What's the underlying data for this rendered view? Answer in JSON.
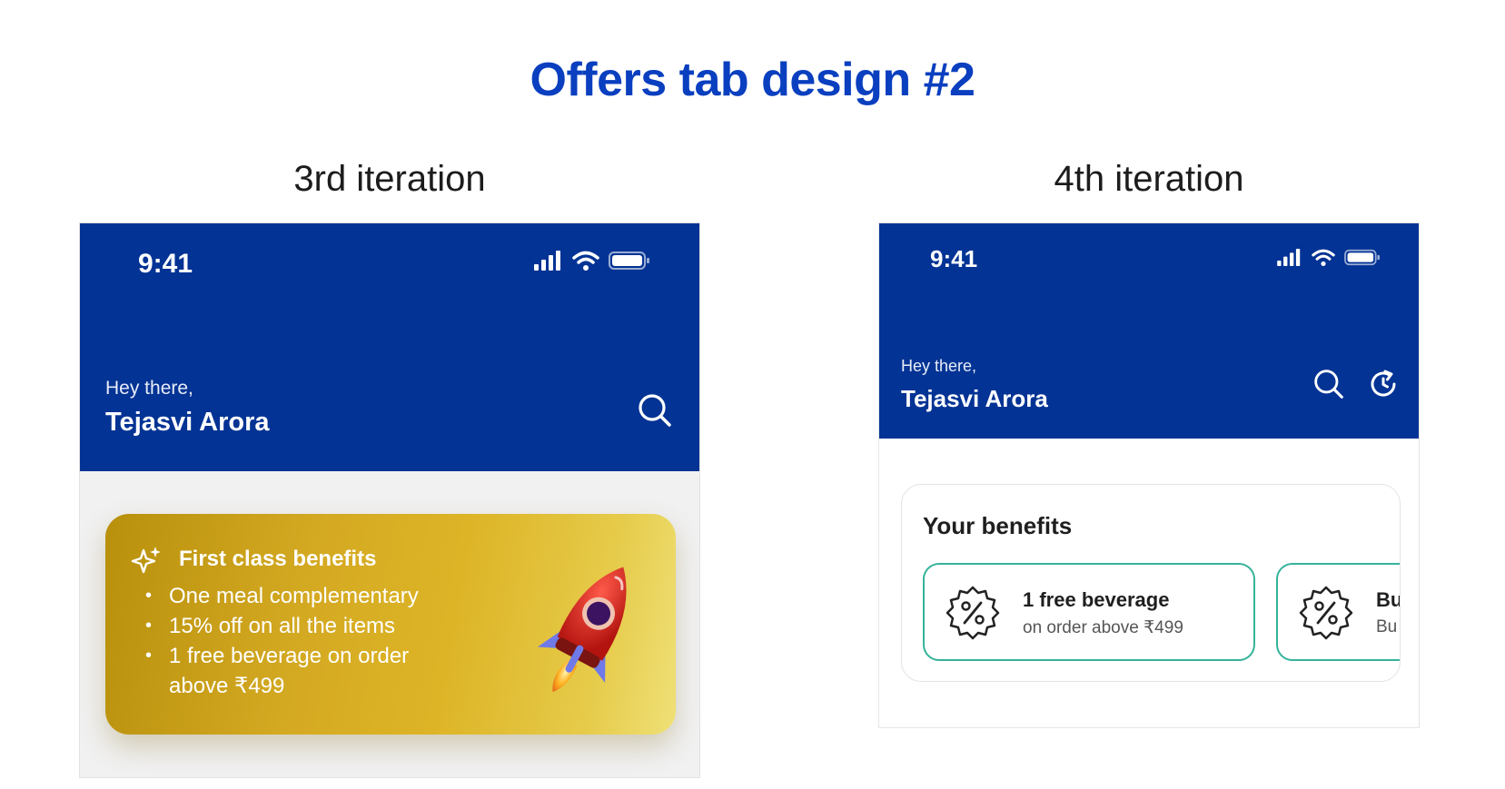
{
  "page": {
    "title": "Offers tab design #2",
    "left_label": "3rd iteration",
    "right_label": "4th iteration"
  },
  "colors": {
    "title_blue": "#0a3fbf",
    "header_blue": "#033394",
    "gold": "#d4a922",
    "benefit_border": "#35b39a"
  },
  "iteration3": {
    "status_time": "9:41",
    "greeting": "Hey there,",
    "user_name": "Tejasvi Arora",
    "header_icons": [
      "search-icon"
    ],
    "card": {
      "title": "First class benefits",
      "items": [
        "One meal complementary",
        "15% off on all the items",
        "1 free beverage on order",
        "above ₹499"
      ],
      "bullet": "•",
      "icons": [
        "sparkle-icon",
        "rocket-icon"
      ]
    }
  },
  "iteration4": {
    "status_time": "9:41",
    "greeting": "Hey there,",
    "user_name": "Tejasvi Arora",
    "header_icons": [
      "search-icon",
      "history-icon"
    ],
    "benefits": {
      "title": "Your benefits",
      "cards": [
        {
          "title": "1 free beverage",
          "subtitle": "on order above ₹499",
          "icon": "discount-badge-icon"
        },
        {
          "title": "Bu",
          "subtitle": "Bu",
          "icon": "discount-badge-icon"
        }
      ]
    }
  }
}
